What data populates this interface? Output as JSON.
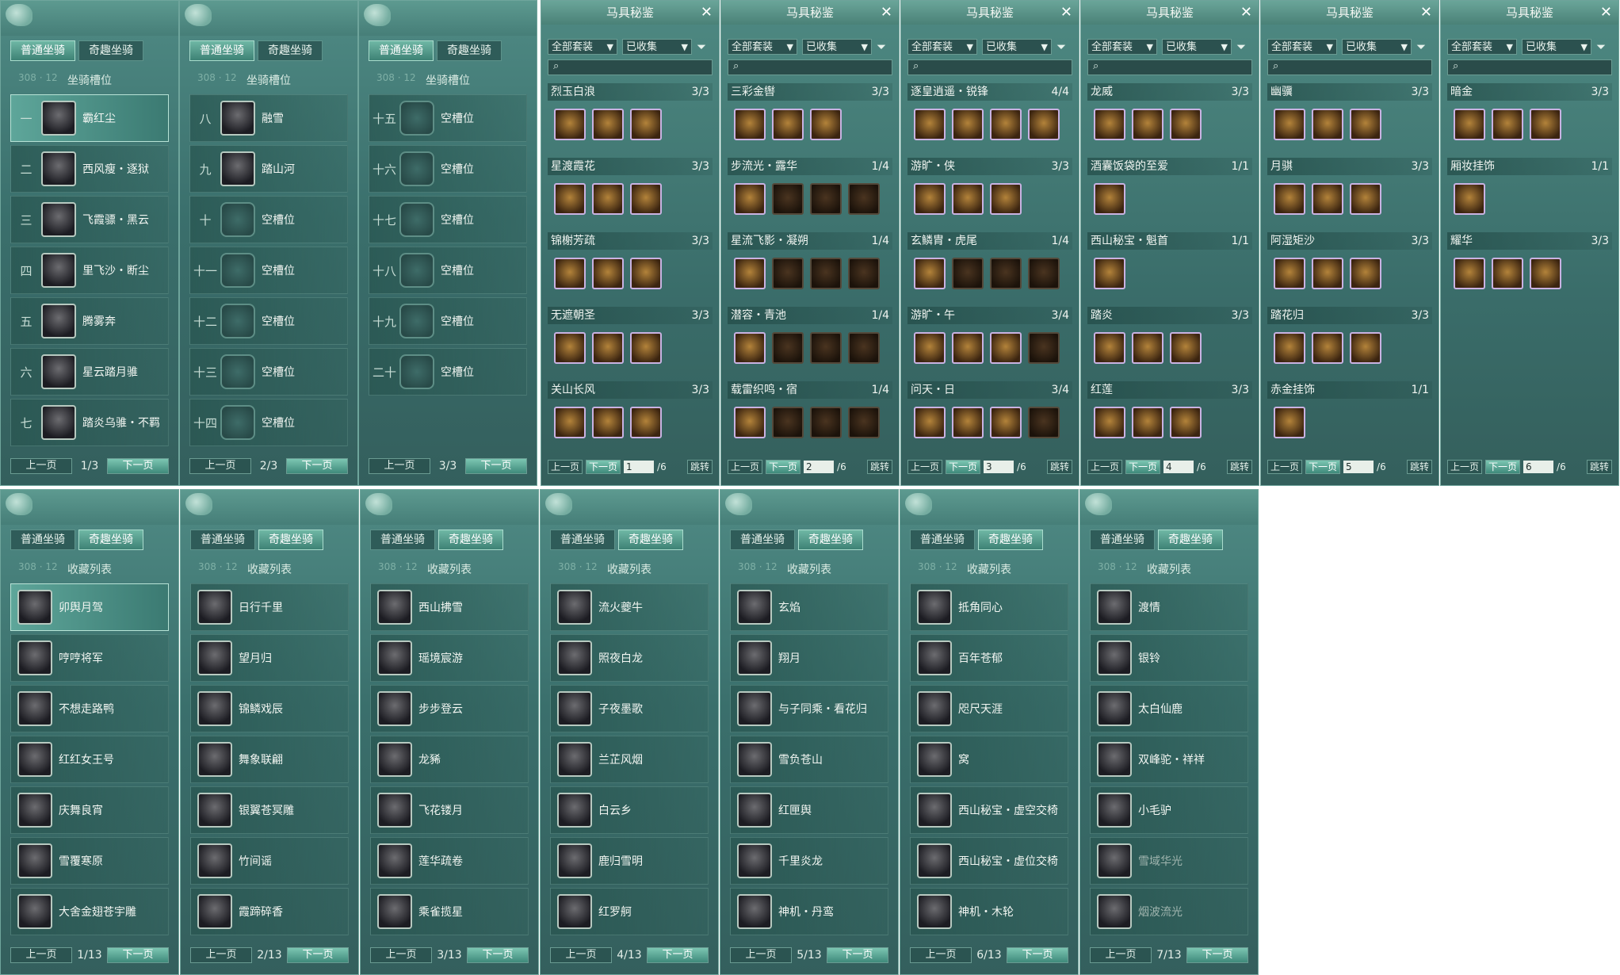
{
  "common": {
    "tab_normal": "普通坐骑",
    "tab_fun": "奇趣坐骑",
    "prev": "上一页",
    "next": "下一页",
    "slot_title": "坐骑槽位",
    "collect_title": "收藏列表",
    "eq_title": "马具秘鉴",
    "eq_filter_all": "全部套装",
    "eq_filter_col": "已收集",
    "eq_jump": "跳转",
    "close_glyph": "✕",
    "search_glyph": "⌕",
    "funnel_glyph": "⏷",
    "caret_glyph": "▼",
    "deco_left": "308 · 12"
  },
  "slot_panels": [
    {
      "page": "1/3",
      "rows": [
        {
          "num": "一",
          "name": "霸红尘"
        },
        {
          "num": "二",
          "name": "西风瘦・逐狱"
        },
        {
          "num": "三",
          "name": "飞霞骠・黑云"
        },
        {
          "num": "四",
          "name": "里飞沙・断尘"
        },
        {
          "num": "五",
          "name": "腾雾奔"
        },
        {
          "num": "六",
          "name": "星云踏月骓"
        },
        {
          "num": "七",
          "name": "踏炎乌骓・不羁"
        }
      ]
    },
    {
      "page": "2/3",
      "rows": [
        {
          "num": "八",
          "name": "融雪"
        },
        {
          "num": "九",
          "name": "踏山河"
        },
        {
          "num": "十",
          "name": "空槽位"
        },
        {
          "num": "十一",
          "name": "空槽位"
        },
        {
          "num": "十二",
          "name": "空槽位"
        },
        {
          "num": "十三",
          "name": "空槽位"
        },
        {
          "num": "十四",
          "name": "空槽位"
        }
      ]
    },
    {
      "page": "3/3",
      "rows": [
        {
          "num": "十五",
          "name": "空槽位"
        },
        {
          "num": "十六",
          "name": "空槽位"
        },
        {
          "num": "十七",
          "name": "空槽位"
        },
        {
          "num": "十八",
          "name": "空槽位"
        },
        {
          "num": "十九",
          "name": "空槽位"
        },
        {
          "num": "二十",
          "name": "空槽位"
        }
      ]
    }
  ],
  "eq_panels": [
    {
      "page": "1",
      "total": "/6",
      "sets": [
        {
          "name": "烈玉白浪",
          "count": "3/3",
          "n": 3
        },
        {
          "name": "星渡霞花",
          "count": "3/3",
          "n": 3
        },
        {
          "name": "锦榭芳疏",
          "count": "3/3",
          "n": 3
        },
        {
          "name": "无遮朝圣",
          "count": "3/3",
          "n": 3
        },
        {
          "name": "关山长风",
          "count": "3/3",
          "n": 3
        }
      ]
    },
    {
      "page": "2",
      "total": "/6",
      "sets": [
        {
          "name": "三彩金辔",
          "count": "3/3",
          "n": 3
        },
        {
          "name": "步流光・露华",
          "count": "1/4",
          "n": 4
        },
        {
          "name": "星流飞影・凝朔",
          "count": "1/4",
          "n": 4
        },
        {
          "name": "潜容・青池",
          "count": "1/4",
          "n": 4
        },
        {
          "name": "载雷织鸣・宿",
          "count": "1/4",
          "n": 4
        }
      ]
    },
    {
      "page": "3",
      "total": "/6",
      "sets": [
        {
          "name": "逐皇逍遥・锐锋",
          "count": "4/4",
          "n": 4
        },
        {
          "name": "游旷・侠",
          "count": "3/3",
          "n": 3
        },
        {
          "name": "玄鳞胄・虎尾",
          "count": "1/4",
          "n": 4
        },
        {
          "name": "游旷・午",
          "count": "3/4",
          "n": 4
        },
        {
          "name": "问天・日",
          "count": "3/4",
          "n": 4
        }
      ]
    },
    {
      "page": "4",
      "total": "/6",
      "sets": [
        {
          "name": "龙威",
          "count": "3/3",
          "n": 3
        },
        {
          "name": "酒囊饭袋的至爱",
          "count": "1/1",
          "n": 1
        },
        {
          "name": "西山秘宝・魁首",
          "count": "1/1",
          "n": 1
        },
        {
          "name": "踏炎",
          "count": "3/3",
          "n": 3
        },
        {
          "name": "红莲",
          "count": "3/3",
          "n": 3
        }
      ]
    },
    {
      "page": "5",
      "total": "/6",
      "sets": [
        {
          "name": "幽骥",
          "count": "3/3",
          "n": 3
        },
        {
          "name": "月骐",
          "count": "3/3",
          "n": 3
        },
        {
          "name": "阿湿矩沙",
          "count": "3/3",
          "n": 3
        },
        {
          "name": "踏花归",
          "count": "3/3",
          "n": 3
        },
        {
          "name": "赤金挂饰",
          "count": "1/1",
          "n": 1
        }
      ]
    },
    {
      "page": "6",
      "total": "/6",
      "sets": [
        {
          "name": "暗金",
          "count": "3/3",
          "n": 3
        },
        {
          "name": "厢妆挂饰",
          "count": "1/1",
          "n": 1
        },
        {
          "name": "耀华",
          "count": "3/3",
          "n": 3
        }
      ]
    }
  ],
  "collect_panels": [
    {
      "page": "1/13",
      "rows": [
        "卯舆月驾",
        "哼哼将军",
        "不想走路鸭",
        "红红女王号",
        "庆舞良宵",
        "雪覆寒原",
        "大舍金翅苍宇雕"
      ]
    },
    {
      "page": "2/13",
      "rows": [
        "日行千里",
        "望月归",
        "锦鳞戏辰",
        "舞象联翩",
        "银翼苍冥雕",
        "竹间谣",
        "霞蹄碎香"
      ]
    },
    {
      "page": "3/13",
      "rows": [
        "西山拂雪",
        "瑶境宸游",
        "步步登云",
        "龙豨",
        "飞花镂月",
        "莲华疏卷",
        "乘雀揽星"
      ]
    },
    {
      "page": "4/13",
      "rows": [
        "流火夔牛",
        "照夜白龙",
        "子夜墨歌",
        "兰芷风烟",
        "白云乡",
        "鹿归雪明",
        "红罗舸"
      ]
    },
    {
      "page": "5/13",
      "rows": [
        "玄焰",
        "翔月",
        "与子同乘・看花归",
        "雪负苍山",
        "红匣舆",
        "千里炎龙",
        "神机・丹鸾"
      ]
    },
    {
      "page": "6/13",
      "rows": [
        "抵角同心",
        "百年苍郁",
        "咫尺天涯",
        "窝",
        "西山秘宝・虚空交椅",
        "西山秘宝・虚位交椅",
        "神机・木轮"
      ]
    },
    {
      "page": "7/13",
      "rows": [
        "渡情",
        "银铃",
        "太白仙鹿",
        "双峰驼・祥祥",
        "小毛驴",
        "雪域华光",
        "烟波流光"
      ]
    }
  ],
  "colors": {
    "panel": "#3a6f6c",
    "accent": "#6fb7a5",
    "slot_border": "#c9b2e2"
  }
}
